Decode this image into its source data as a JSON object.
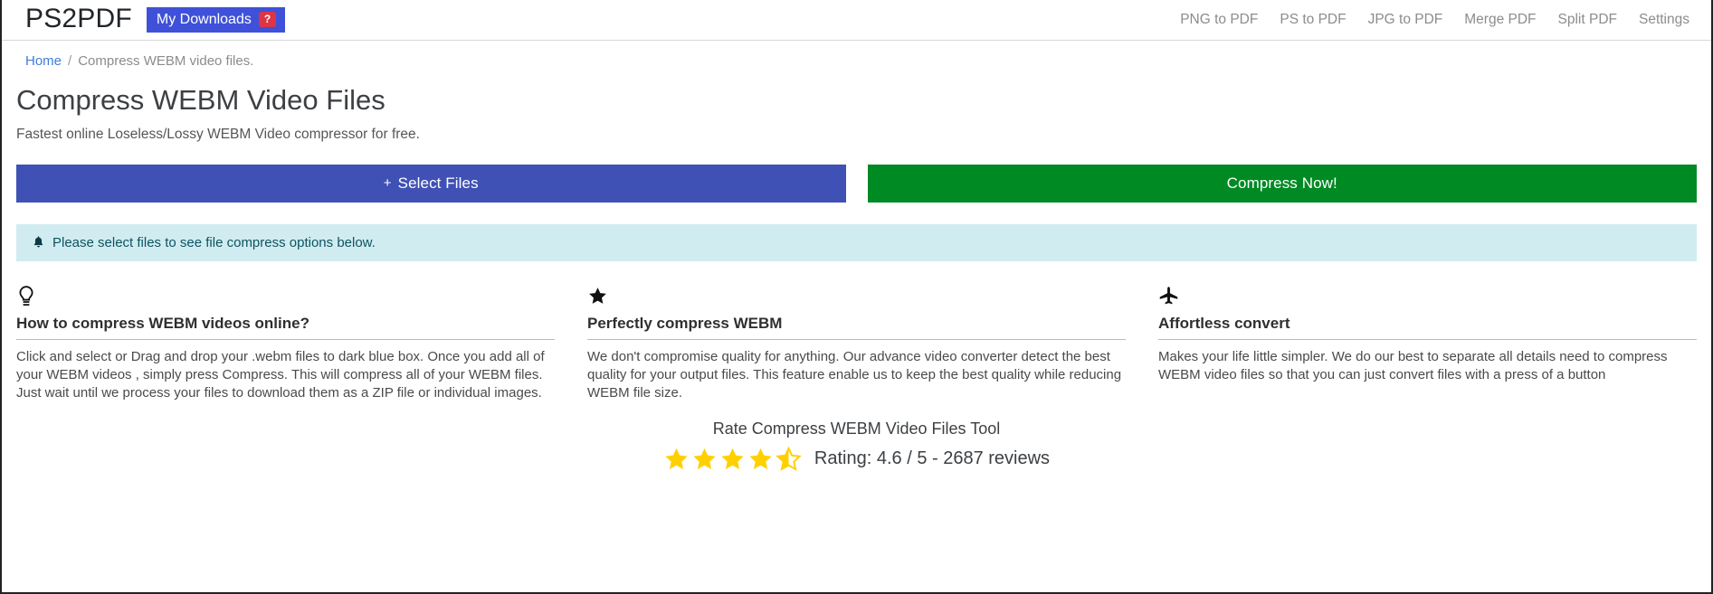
{
  "topbar": {
    "brand": "PS2PDF",
    "downloads_label": "My Downloads",
    "downloads_badge": "?",
    "nav": [
      {
        "label": "PNG to PDF"
      },
      {
        "label": "PS to PDF"
      },
      {
        "label": "JPG to PDF"
      },
      {
        "label": "Merge PDF"
      },
      {
        "label": "Split PDF"
      },
      {
        "label": "Settings"
      }
    ],
    "colors": {
      "downloads_bg": "#3f51d8",
      "badge_bg": "#dc3545",
      "nav_link": "#8c8c8c"
    }
  },
  "breadcrumb": {
    "home": "Home",
    "separator": "/",
    "current": "Compress WEBM video files."
  },
  "header": {
    "title": "Compress WEBM Video Files",
    "subtitle": "Fastest online Loseless/Lossy WEBM Video compressor for free."
  },
  "actions": {
    "select_plus": "+",
    "select_label": "Select Files",
    "compress_label": "Compress Now!",
    "colors": {
      "select_bg": "#3f51b5",
      "compress_bg": "#008a23"
    }
  },
  "alert": {
    "icon": "bell-icon",
    "message": "Please select files to see file compress options below.",
    "colors": {
      "bg": "#d1ecf1",
      "text": "#0c5460"
    }
  },
  "features": [
    {
      "icon": "lightbulb-icon",
      "title": "How to compress WEBM videos online?",
      "body": "Click and select or Drag and drop your .webm files to dark blue box. Once you add all of your WEBM videos , simply press Compress. This will compress all of your WEBM files. Just wait until we process your files to download them as a ZIP file or individual images."
    },
    {
      "icon": "star-icon",
      "title": "Perfectly compress WEBM",
      "body": "We don't compromise quality for anything. Our advance video converter detect the best quality for your output files. This feature enable us to keep the best quality while reducing WEBM file size."
    },
    {
      "icon": "airplane-icon",
      "title": "Affortless convert",
      "body": "Makes your life little simpler. We do our best to separate all details need to compress WEBM video files so that you can just convert files with a press of a button"
    }
  ],
  "rating": {
    "title": "Rate Compress WEBM Video Files Tool",
    "text": "Rating: 4.6 / 5 - 2687 reviews",
    "score": "4.6",
    "max": "5",
    "reviews": "2687",
    "filled_stars": 4,
    "half_stars": 1,
    "star_color": "#ffd000"
  }
}
